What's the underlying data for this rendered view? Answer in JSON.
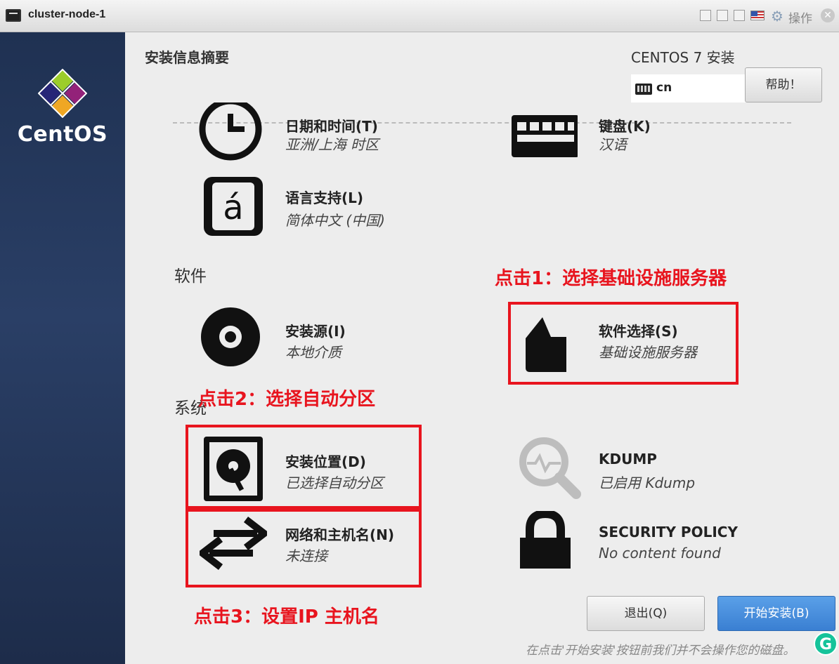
{
  "window": {
    "title": "cluster-node-1",
    "action_label": "操作"
  },
  "brand": {
    "logo_text": "CentOS"
  },
  "header": {
    "page_title": "安装信息摘要",
    "product": "CENTOS 7 安装",
    "keyboard_layout": "cn",
    "help_label": "帮助！"
  },
  "sections": {
    "software": "软件",
    "system": "系统"
  },
  "spokes": {
    "datetime": {
      "title": "日期和时间(T)",
      "status": "亚洲/上海 时区"
    },
    "keyboard": {
      "title": "键盘(K)",
      "status": "汉语"
    },
    "language": {
      "title": "语言支持(L)",
      "status": "简体中文 (中国)"
    },
    "source": {
      "title": "安装源(I)",
      "status": "本地介质"
    },
    "software_selection": {
      "title": "软件选择(S)",
      "status": "基础设施服务器"
    },
    "destination": {
      "title": "安装位置(D)",
      "status": "已选择自动分区"
    },
    "kdump": {
      "title": "KDUMP",
      "status": "已启用 Kdump"
    },
    "network": {
      "title": "网络和主机名(N)",
      "status": "未连接"
    },
    "security": {
      "title": "SECURITY POLICY",
      "status": "No content found"
    }
  },
  "annotations": {
    "step1": "点击1：选择基础设施服务器",
    "step2": "点击2：选择自动分区",
    "step3": "点击3：设置IP 主机名",
    "color": "#e8141e"
  },
  "footer": {
    "quit_label": "退出(Q)",
    "begin_label": "开始安装(B)",
    "note": "在点击'开始安装'按钮前我们并不会操作您的磁盘。"
  },
  "colors": {
    "sidebar": "#24375c",
    "primary_button": "#3a7fd2",
    "annotation": "#e8141e"
  },
  "icons": {
    "datetime": "clock-icon",
    "keyboard": "keyboard-icon",
    "language": "language-icon",
    "source": "disc-icon",
    "software_selection": "package-icon",
    "destination": "harddisk-icon",
    "kdump": "magnifier-icon",
    "network": "network-arrows-icon",
    "security": "lock-icon"
  }
}
